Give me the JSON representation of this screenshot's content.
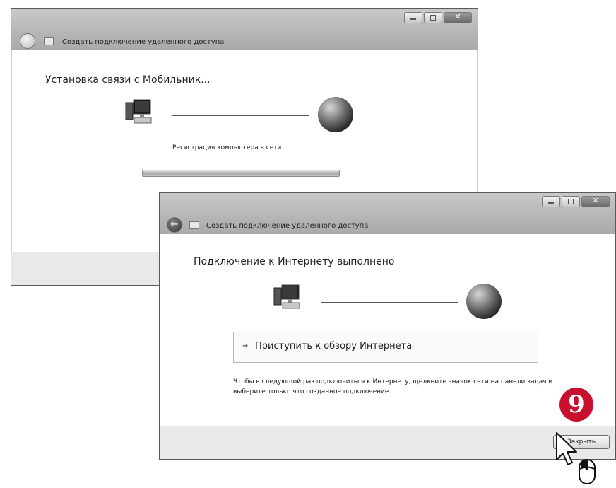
{
  "window1": {
    "title": "Создать подключение удаленного доступа",
    "heading": "Установка связи с Мобильник...",
    "status": "Регистрация компьютера в сети...",
    "progress": 1.0
  },
  "window2": {
    "title": "Создать подключение удаленного доступа",
    "heading": "Подключение к Интернету выполнено",
    "browse_label": "Приступить к обзору Интернета",
    "hint": "Чтобы в следующий раз подключиться к Интернету, щелкните значок сети на панели задач и выберите только что созданное подключение.",
    "close_label": "Закрыть"
  },
  "step_badge": "9",
  "icons": {
    "back": "back-arrow-icon",
    "folder": "folder-icon",
    "computer": "computer-icon",
    "globe": "globe-icon",
    "minimize": "minimize-icon",
    "maximize": "maximize-icon",
    "close": "close-icon",
    "cursor": "mouse-pointer-icon"
  },
  "colors": {
    "badge": "#c8102e",
    "titlebar": "#b5b5b5"
  }
}
